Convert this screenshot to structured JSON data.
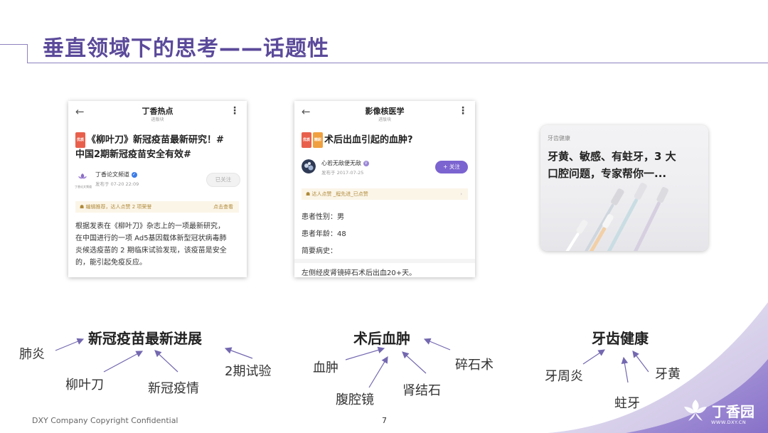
{
  "title": "垂直领域下的思考——话题性",
  "colors": {
    "accent": "#5b4a9a",
    "follow_button": "#7b63d0",
    "verified": "#3b7be8"
  },
  "cards": [
    {
      "nav_title": "丁香热点",
      "nav_subtitle": "进版块",
      "badge": "优质",
      "headline_line1": "《柳叶刀》新冠疫苗最新研究！#",
      "headline_line2": "中国2期新冠疫苗安全有效#",
      "avatar_label": "丁香论文频道",
      "author": "丁香论文频道",
      "meta": "发布于 07-20 22:09",
      "follow_label": "已关注",
      "notice": "编辑推荐，达人点赞 2 项荣誉",
      "notice_action": "点击查看",
      "body_lines": [
        "根据发表在《柳叶刀》杂志上的一项最新研究，",
        "在中国进行的一项 Ad5基因载体新型冠状病毒肺",
        "炎候选疫苗的 2 期临床试验发现，该疫苗是安全",
        "的，能引起免疫反应。"
      ]
    },
    {
      "nav_title": "影像核医学",
      "nav_subtitle": "进版块",
      "badge1": "优质",
      "badge2": "精彩",
      "headline": "术后出血引起的血肿?",
      "author": "心若无敌便无敌",
      "meta": "发布于 2017-07-25",
      "follow_label": "+ 关注",
      "notice": "达人点赞 _程先进_已点赞",
      "fields": [
        "患者性别：男",
        "患者年龄：48",
        "简要病史：",
        "左侧经皮肾镜碎石术后出血20+天。"
      ]
    },
    {
      "category": "牙齿健康",
      "headline_line1": "牙黄、敏感、有蛀牙，3 大",
      "headline_line2": "口腔问题，专家帮你一..."
    }
  ],
  "topics": [
    {
      "main": "新冠疫苗最新进展",
      "keywords": [
        "肺炎",
        "柳叶刀",
        "新冠疫情",
        "2期试验"
      ]
    },
    {
      "main": "术后血肿",
      "keywords": [
        "血肿",
        "腹腔镜",
        "肾结石",
        "碎石术"
      ]
    },
    {
      "main": "牙齿健康",
      "keywords": [
        "牙周炎",
        "蛀牙",
        "牙黄"
      ]
    }
  ],
  "footer": "DXY Company Copyright Confidential",
  "page_number": "7",
  "logo": {
    "text": "丁香园",
    "url": "WWW.DXY.CN"
  }
}
